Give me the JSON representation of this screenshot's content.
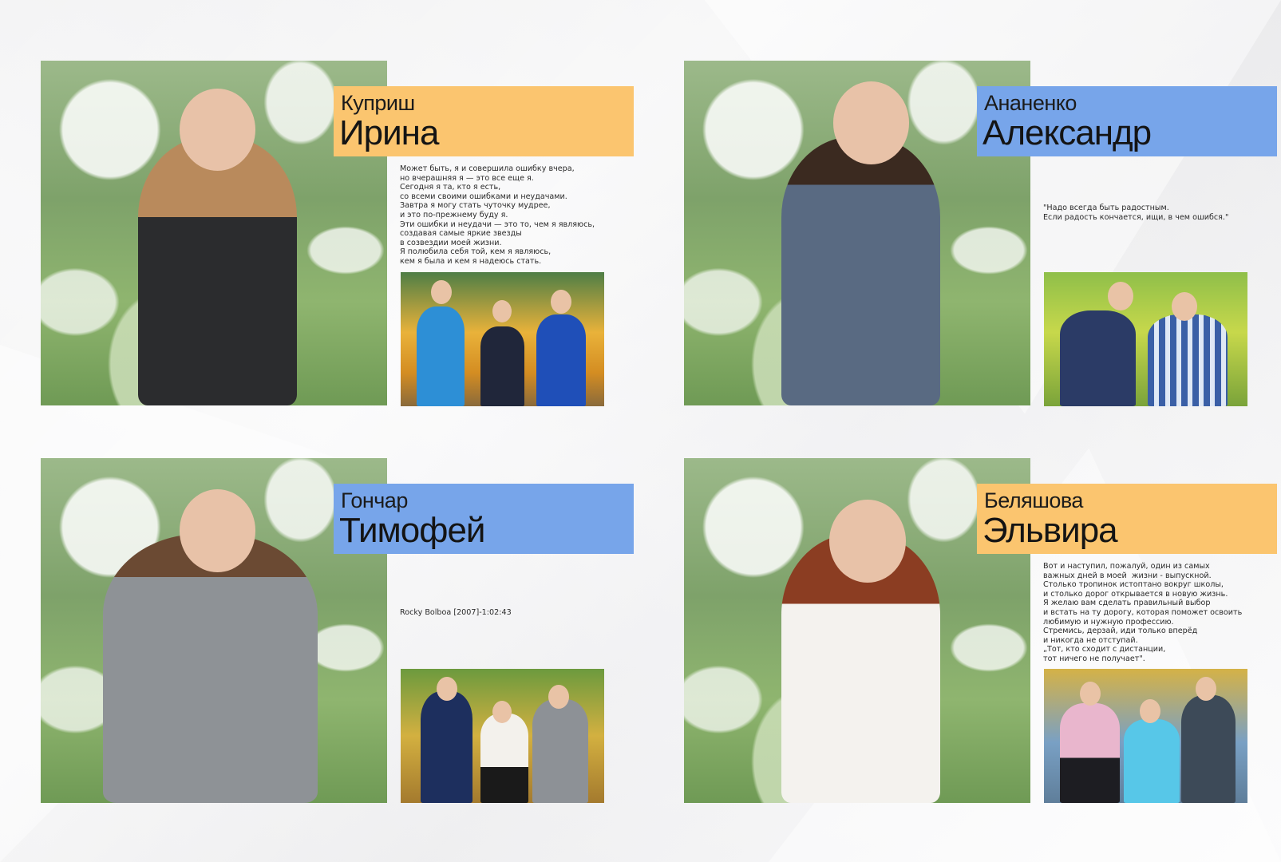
{
  "colors": {
    "orange": "#fbc56f",
    "blue": "#77a5ea",
    "background": "#f2f2f3"
  },
  "students": [
    {
      "surname": "Куприш",
      "name": "Ирина",
      "accent": "orange",
      "quote": "Может быть, я и совершила ошибку вчера,\nно вчерашняя я — это все еще я.\nСегодня я та, кто я есть,\nсо всеми своими ошибками и неудачами.\nЗавтра я могу стать чуточку мудрее,\nи это по-прежнему буду я.\nЭти ошибки и неудачи — это то, чем я являюсь,\nсоздавая самые яркие звезды\nв созвездии моей жизни.\nЯ полюбила себя той, кем я являюсь,\nкем я была и кем я надеюсь стать."
    },
    {
      "surname": "Ананенко",
      "name": "Александр",
      "accent": "blue",
      "quote": "\"Надо всегда быть радостным.\nЕсли радость кончается, ищи, в чем ошибся.\""
    },
    {
      "surname": "Гончар",
      "name": "Тимофей",
      "accent": "blue",
      "quote": "Rocky Bolboa [2007]-1:02:43"
    },
    {
      "surname": "Беляшова",
      "name": "Эльвира",
      "accent": "orange",
      "quote": "Вот и наступил, пожалуй, один из самых\nважных дней в моей  жизни - выпускной.\nСтолько тропинок истоптано вокруг школы,\nи столько дорог открывается в новую жизнь.\nЯ желаю вам сделать правильный выбор\nи встать на ту дорогу, которая поможет освоить\nлюбимую и нужную профессию.\nСтремись, дерзай, иди только вперёд\nи никогда не отступай.\n„Тот, кто сходит с дистанции,\nтот ничего не получает\"."
    }
  ]
}
